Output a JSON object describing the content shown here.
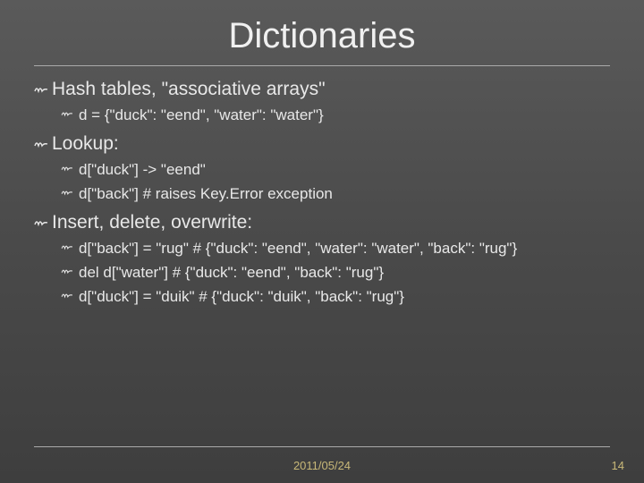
{
  "title": "Dictionaries",
  "bullets": {
    "b1": "Hash tables, \"associative arrays\"",
    "b1_1": "d = {\"duck\": \"eend\", \"water\": \"water\"}",
    "b2": "Lookup:",
    "b2_1": "d[\"duck\"] -> \"eend\"",
    "b2_2": "d[\"back\"] # raises Key.Error exception",
    "b3": "Insert, delete, overwrite:",
    "b3_1": "d[\"back\"] = \"rug\" # {\"duck\": \"eend\", \"water\": \"water\", \"back\": \"rug\"}",
    "b3_2": "del d[\"water\"] # {\"duck\": \"eend\", \"back\": \"rug\"}",
    "b3_3": "d[\"duck\"] = \"duik\" # {\"duck\": \"duik\", \"back\": \"rug\"}"
  },
  "footer": {
    "date": "2011/05/24",
    "page": "14"
  }
}
